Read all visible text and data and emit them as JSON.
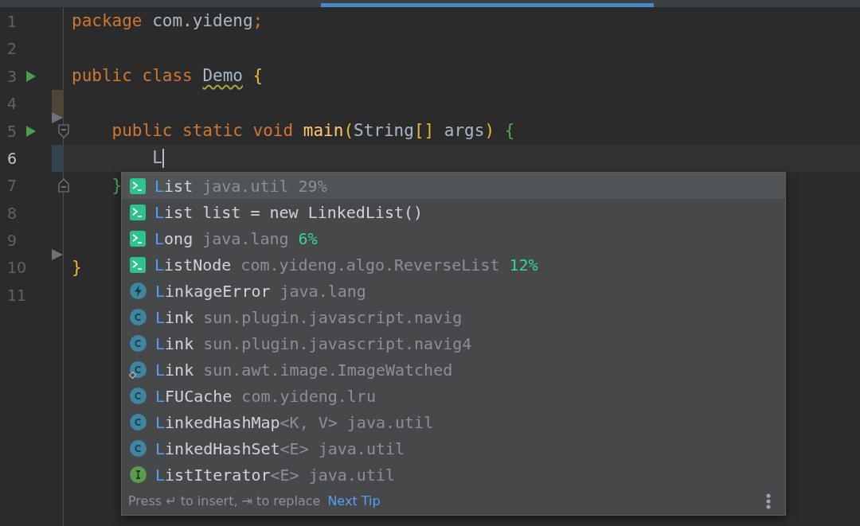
{
  "editor": {
    "lines": [
      {
        "number": "1",
        "current": false,
        "tokens": [
          {
            "text": "package ",
            "kind": "keyword"
          },
          {
            "text": "com.yideng",
            "kind": "plain"
          },
          {
            "text": ";",
            "kind": "keyword"
          }
        ]
      },
      {
        "number": "2",
        "current": false
      },
      {
        "number": "3",
        "current": false,
        "run": true,
        "tokens": [
          {
            "text": "public class ",
            "kind": "keyword"
          },
          {
            "text": "Demo",
            "kind": "warning"
          },
          {
            "text": " {",
            "kind": "bracket-yellow"
          }
        ]
      },
      {
        "number": "4",
        "current": false,
        "modified": true,
        "deleted_after": true
      },
      {
        "number": "5",
        "current": false,
        "run": true,
        "fold_start": true,
        "tokens": [
          {
            "text": "    public static void ",
            "kind": "keyword"
          },
          {
            "text": "main",
            "kind": "method"
          },
          {
            "text": "(",
            "kind": "bracket-yellow"
          },
          {
            "text": "String",
            "kind": "plain"
          },
          {
            "text": "[]",
            "kind": "bracket-yellow"
          },
          {
            "text": " args",
            "kind": "plain"
          },
          {
            "text": ")",
            "kind": "bracket-yellow"
          },
          {
            "text": " {",
            "kind": "bracket-green"
          }
        ]
      },
      {
        "number": "6",
        "current": true,
        "added": true,
        "tokens": [
          {
            "text": "        L",
            "kind": "plain"
          }
        ]
      },
      {
        "number": "7",
        "current": false,
        "fold_end": true,
        "tokens": [
          {
            "text": "    }",
            "kind": "bracket-green"
          }
        ]
      },
      {
        "number": "8",
        "current": false
      },
      {
        "number": "9",
        "current": false,
        "deleted_after": true
      },
      {
        "number": "10",
        "current": false,
        "tokens": [
          {
            "text": "}",
            "kind": "bracket-yellow"
          }
        ]
      },
      {
        "number": "11",
        "current": false
      }
    ]
  },
  "completion": {
    "items": [
      {
        "kind": "live-template",
        "selected": true,
        "name": "List",
        "detail": "java.util",
        "relevance": {
          "text": "29%",
          "highlighted": false
        }
      },
      {
        "kind": "live-template",
        "selected": false,
        "name": "List list = new LinkedList()"
      },
      {
        "kind": "live-template",
        "selected": false,
        "name": "Long",
        "detail": "java.lang",
        "relevance": {
          "text": "6%",
          "highlighted": true
        }
      },
      {
        "kind": "live-template",
        "selected": false,
        "name": "ListNode",
        "detail": "com.yideng.algo.ReverseList",
        "relevance": {
          "text": "12%",
          "highlighted": true
        }
      },
      {
        "kind": "exception",
        "selected": false,
        "name": "LinkageError",
        "detail": "java.lang"
      },
      {
        "kind": "class",
        "selected": false,
        "name": "Link",
        "detail": "sun.plugin.javascript.navig"
      },
      {
        "kind": "class",
        "selected": false,
        "name": "Link",
        "detail": "sun.plugin.javascript.navig4"
      },
      {
        "kind": "class",
        "selected": false,
        "pinned": true,
        "name": "Link",
        "detail": "sun.awt.image.ImageWatched"
      },
      {
        "kind": "class",
        "selected": false,
        "name": "LFUCache",
        "detail": "com.yideng.lru"
      },
      {
        "kind": "class",
        "selected": false,
        "name": "LinkedHashMap",
        "generic": "<K, V>",
        "detail": "java.util"
      },
      {
        "kind": "class",
        "selected": false,
        "name": "LinkedHashSet",
        "generic": "<E>",
        "detail": "java.util"
      },
      {
        "kind": "interface",
        "selected": false,
        "name": "ListIterator",
        "generic": "<E>",
        "detail": "java.util"
      }
    ],
    "footer": {
      "hint": "Press ↵ to insert, ⇥ to replace",
      "link": "Next Tip"
    }
  }
}
